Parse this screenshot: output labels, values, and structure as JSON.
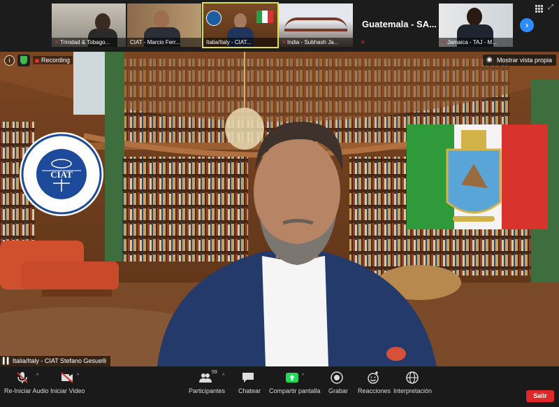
{
  "thumbnails": [
    {
      "label": "Trinidad & Tobago..."
    },
    {
      "label": "CIAT - Marcio Ferr..."
    },
    {
      "label": "Italia/Italy - CIAT..."
    },
    {
      "label": "India - Subhash Ja..."
    },
    {
      "name": "Guatemala - SA..."
    },
    {
      "label": "Jamaica - TAJ - M..."
    }
  ],
  "stage": {
    "recording_label": "Recording",
    "view_label": "Mostrar vista propia",
    "speaker_label": "Italia/Italy - CIAT  Stefano Gesuelli",
    "logo": {
      "top_text": "CENTRO INTERAMERICANO DE ADMINISTRACIONES TRIBUTARIAS",
      "center_text": "CIAT",
      "bottom_text": "FUNDADO 1967"
    }
  },
  "toolbar": {
    "audio_label": "Re-Iniciar Audio",
    "video_label": "Iniciar Video",
    "participants_label": "Participantes",
    "participants_count": "59",
    "chat_label": "Chatear",
    "share_label": "Compartir pantalla",
    "record_label": "Grabar",
    "reactions_label": "Reacciones",
    "translation_label": "Interpretación",
    "leave_label": "Salir"
  },
  "colors": {
    "accent_blue": "#2d8cff",
    "share_green": "#23d959",
    "leave_red": "#e02828",
    "active_outline": "#d8e24a"
  }
}
